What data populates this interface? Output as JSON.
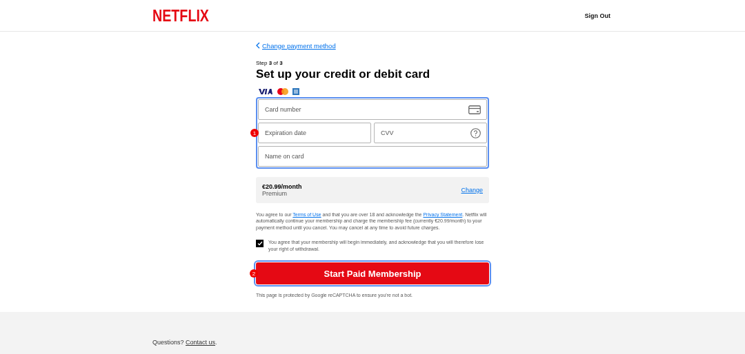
{
  "header": {
    "logo": "NETFLIX",
    "sign_out": "Sign Out"
  },
  "back_link": "Change payment method",
  "step": {
    "prefix": "Step ",
    "current": "3",
    "middle": " of ",
    "total": "3"
  },
  "title": "Set up your credit or debit card",
  "card_form": {
    "badge": "1",
    "fields": [
      {
        "placeholder": "Card number",
        "kind": "card"
      },
      {
        "placeholder": "Expiration date",
        "kind": "plain"
      },
      {
        "placeholder": "CVV",
        "kind": "help"
      },
      {
        "placeholder": "Name on card",
        "kind": "plain"
      }
    ]
  },
  "plan": {
    "price": "€20.99/month",
    "name": "Premium",
    "change": "Change"
  },
  "legal": [
    {
      "kind": "text",
      "text": "You agree to our "
    },
    {
      "kind": "link",
      "text": "Terms of Use"
    },
    {
      "kind": "text",
      "text": " and that you are over 18 and acknowledge the "
    },
    {
      "kind": "link",
      "text": "Privacy Statement"
    },
    {
      "kind": "text",
      "text": ". Netflix will automatically continue your membership and charge the membership fee (currently €20.99/month) to your payment method until you cancel. You may cancel at any time to avoid future charges."
    }
  ],
  "consent": {
    "checked": true,
    "text": "You agree that your membership will begin immediately, and acknowledge that you will therefore lose your right of withdrawal."
  },
  "submit": {
    "badge": "2",
    "label": "Start Paid Membership"
  },
  "recaptcha": "This page is protected by Google reCAPTCHA to ensure you're not a bot.",
  "footer": {
    "question": "Questions? ",
    "link": "Contact us",
    "end": "."
  }
}
